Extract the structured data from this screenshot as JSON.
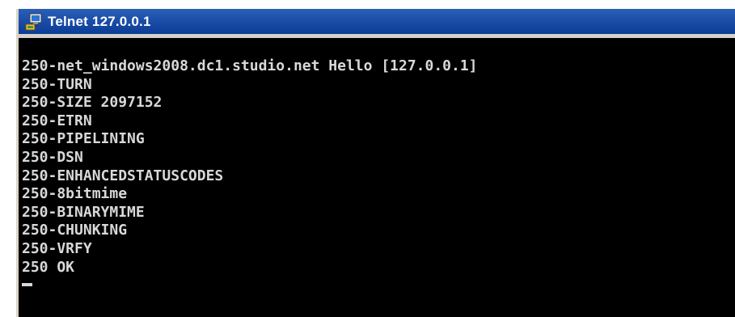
{
  "window": {
    "title": "Telnet 127.0.0.1",
    "icon": "telnet-computer-icon"
  },
  "console": {
    "lines": [
      "250-net_windows2008.dc1.studio.net Hello [127.0.0.1]",
      "250-TURN",
      "250-SIZE 2097152",
      "250-ETRN",
      "250-PIPELINING",
      "250-DSN",
      "250-ENHANCEDSTATUSCODES",
      "250-8bitmime",
      "250-BINARYMIME",
      "250-CHUNKING",
      "250-VRFY",
      "250 OK"
    ]
  },
  "colors": {
    "titlebar": "#0b3b96",
    "console_background": "#000000",
    "console_text": "#d8d8d8"
  }
}
